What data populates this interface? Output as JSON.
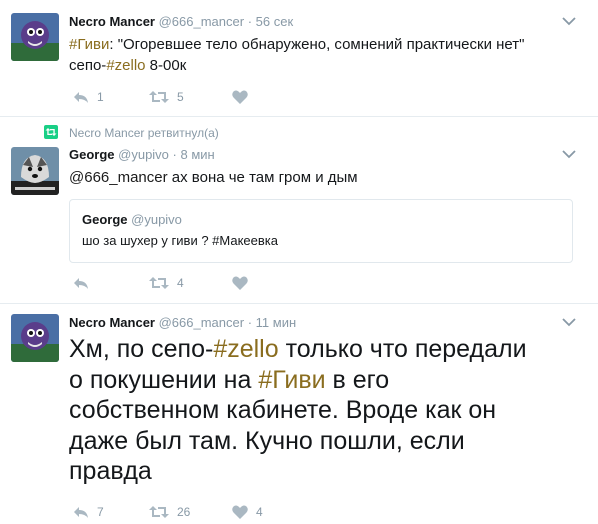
{
  "tweets": [
    {
      "name": "Necro Mancer",
      "handle": "@666_mancer",
      "sep": "·",
      "time": "56 сек",
      "text_parts": [
        "#Гиви",
        ": \"Огоревшее тело обнаружено, сомнений практически нет\"",
        "сепо-",
        "#zello",
        " 8-00к"
      ],
      "reply_count": "1",
      "retweet_count": "5",
      "like_count": ""
    },
    {
      "retweet_context": "Necro Mancer ретвитнул(а)",
      "name": "George",
      "handle": "@yupivo",
      "sep": "·",
      "time": "8 мин",
      "text_parts": [
        "@666_mancer",
        " ах вона че там гром и дым"
      ],
      "quote": {
        "name": "George",
        "handle": "@yupivo",
        "text": "шо за шухер у гиви ? #Макеевка"
      },
      "reply_count": "",
      "retweet_count": "4",
      "like_count": ""
    },
    {
      "name": "Necro Mancer",
      "handle": "@666_mancer",
      "sep": "·",
      "time": "11 мин",
      "text_parts": [
        "Хм, по сепо-",
        "#zello",
        " только что передали",
        "о покушении на ",
        "#Гиви",
        " в его",
        "собственном кабинете. Вроде как он",
        "даже был там. Кучно пошли, если",
        "правда"
      ],
      "reply_count": "7",
      "retweet_count": "26",
      "like_count": "4"
    }
  ],
  "colors": {
    "text": "#14171a",
    "muted": "#8899a6",
    "hashtag": "#8a6d1f",
    "retweet_green": "#19cf86",
    "divider": "#e6ecf0",
    "icon": "#aab8c2"
  },
  "icons": [
    "reply-icon",
    "retweet-icon",
    "like-icon",
    "caret-down-icon",
    "retweet-context-icon",
    "avatar-image"
  ]
}
